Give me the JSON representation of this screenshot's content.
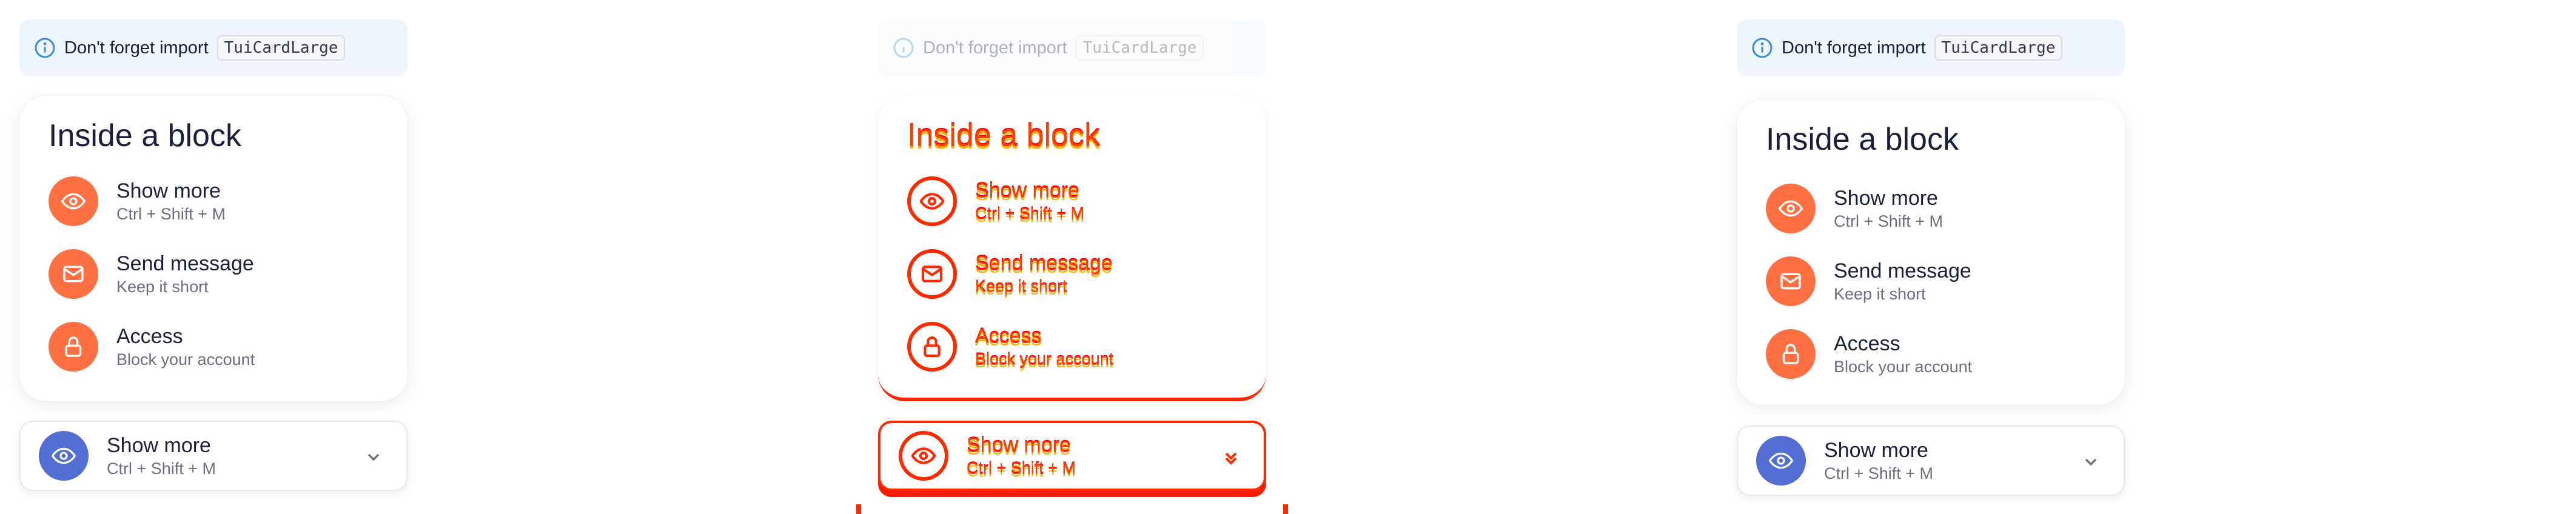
{
  "notice": {
    "text": "Don't forget import",
    "code": "TuiCardLarge",
    "icon": "info-icon"
  },
  "card": {
    "title": "Inside a block",
    "items": [
      {
        "title": "Show more",
        "subtitle": "Ctrl + Shift + M",
        "icon": "eye-icon"
      },
      {
        "title": "Send message",
        "subtitle": "Keep it short",
        "icon": "mail-icon"
      },
      {
        "title": "Access",
        "subtitle": "Block your account",
        "icon": "lock-icon"
      }
    ]
  },
  "dropdown": {
    "title": "Show more",
    "subtitle": "Ctrl + Shift + M",
    "icon": "eye-icon",
    "chevron": "chevron-down-icon"
  },
  "colors": {
    "accent": "#ff7043",
    "primary": "#526ed3",
    "info": "#3c8ad9",
    "notice_bg": "#eef5fc",
    "error_overlay": "#ff2a00"
  }
}
